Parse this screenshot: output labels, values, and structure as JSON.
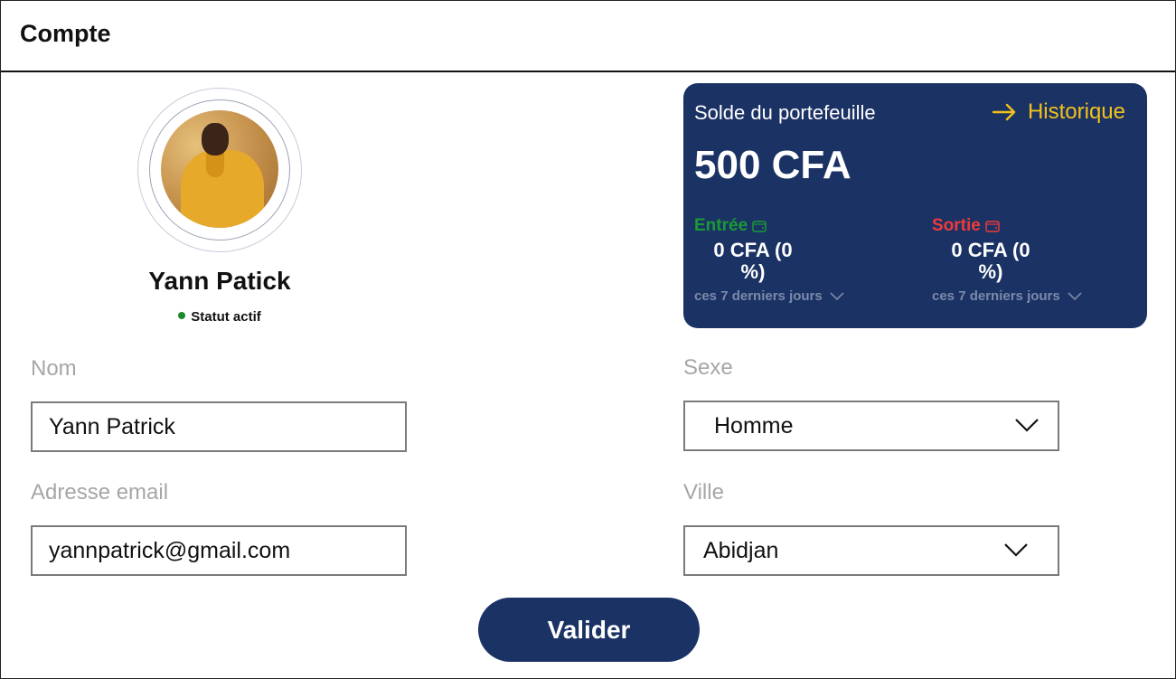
{
  "header": {
    "title": "Compte"
  },
  "profile": {
    "name": "Yann Patick",
    "status": "Statut actif"
  },
  "wallet": {
    "label": "Solde du portefeuille",
    "history_link": "Historique",
    "balance": "500 CFA",
    "income": {
      "title": "Entrée",
      "value": "0 CFA (0 %)",
      "period": "ces 7 derniers jours"
    },
    "expense": {
      "title": "Sortie",
      "value": "0 CFA (0 %)",
      "period": "ces 7 derniers jours"
    },
    "colors": {
      "card": "#1b3265",
      "link": "#f2c21b",
      "income": "#1a9a33",
      "expense": "#ef3a3a"
    }
  },
  "form": {
    "name": {
      "label": "Nom",
      "value": "Yann Patrick"
    },
    "email": {
      "label": "Adresse email",
      "value": "yannpatrick@gmail.com"
    },
    "sex": {
      "label": "Sexe",
      "value": "Homme"
    },
    "city": {
      "label": "Ville",
      "value": "Abidjan"
    },
    "submit_label": "Valider"
  }
}
